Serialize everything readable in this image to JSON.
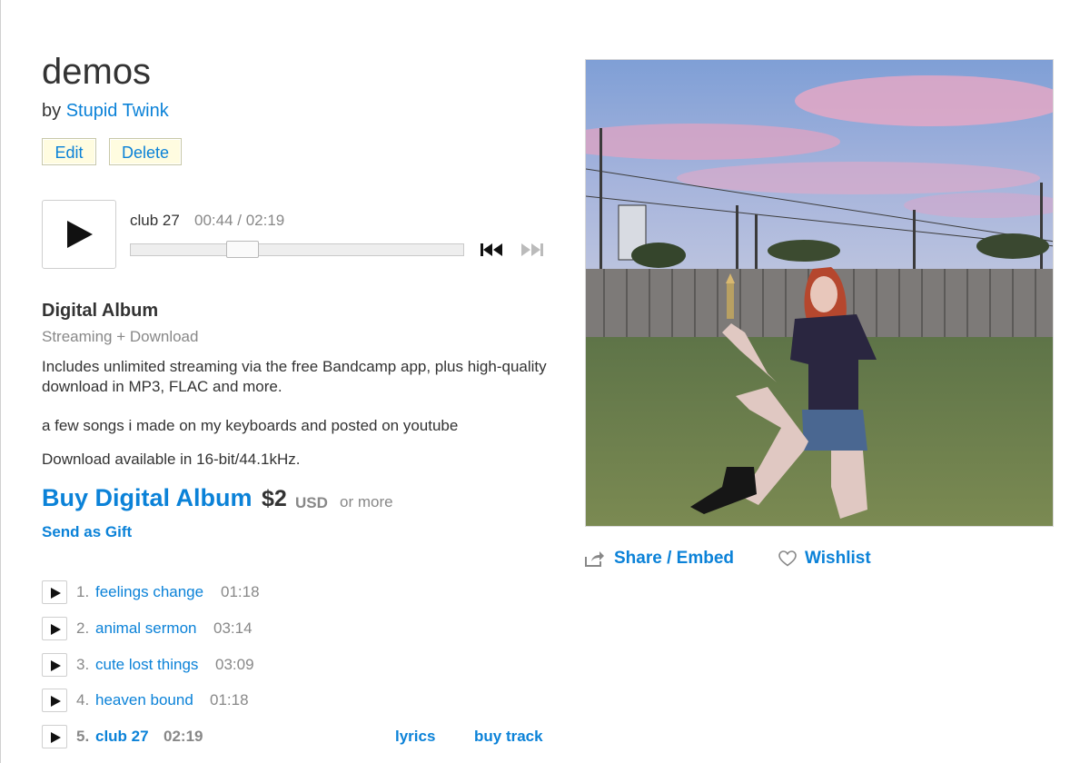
{
  "album": {
    "title": "demos",
    "by_prefix": "by",
    "artist": "Stupid Twink"
  },
  "admin": {
    "edit_label": "Edit",
    "delete_label": "Delete"
  },
  "player": {
    "track_title": "club 27",
    "time": "00:44 / 02:19",
    "progress_fraction": 0.32
  },
  "package": {
    "title": "Digital Album",
    "subtitle": "Streaming + Download",
    "description": "Includes unlimited streaming via the free Bandcamp app, plus high-quality download in MP3, FLAC and more.",
    "about": "a few songs i made on my keyboards and posted on youtube",
    "download_note": "Download available in 16-bit/44.1kHz.",
    "buy_label": "Buy Digital Album",
    "price": "$2",
    "currency": "USD",
    "or_more": "or more",
    "gift_label": "Send as Gift"
  },
  "tracks": [
    {
      "num": "1.",
      "title": "feelings change",
      "duration": "01:18"
    },
    {
      "num": "2.",
      "title": "animal sermon",
      "duration": "03:14"
    },
    {
      "num": "3.",
      "title": "cute lost things",
      "duration": "03:09"
    },
    {
      "num": "4.",
      "title": "heaven bound",
      "duration": "01:18"
    },
    {
      "num": "5.",
      "title": "club 27",
      "duration": "02:19",
      "lyrics_label": "lyrics",
      "buy_label": "buy track"
    }
  ],
  "actions": {
    "share_label": "Share / Embed",
    "wishlist_label": "Wishlist"
  },
  "colors": {
    "link": "#0b82d8",
    "admin_button_bg": "#fffce0"
  },
  "icons": [
    "play-icon",
    "prev-track-icon",
    "next-track-icon",
    "share-icon",
    "heart-icon"
  ]
}
